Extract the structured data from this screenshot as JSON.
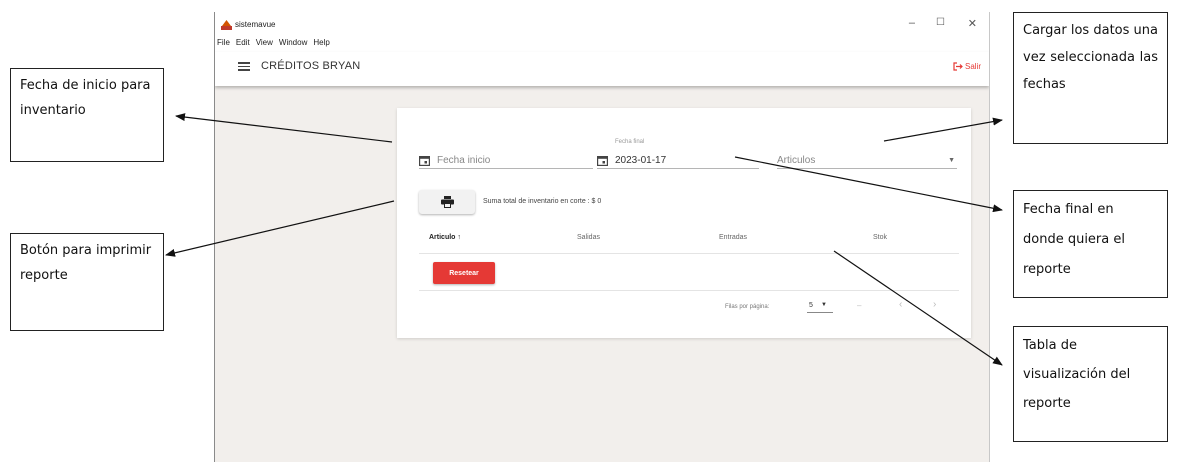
{
  "window": {
    "app_title": "sistemavue",
    "controls": {
      "minimize": "–",
      "maximize": "☐",
      "close": "✕"
    },
    "menu": [
      "File",
      "Edit",
      "View",
      "Window",
      "Help"
    ]
  },
  "toolbar": {
    "title": "CRÉDITOS BRYAN",
    "logout_label": "Salir"
  },
  "filters": {
    "start_date": {
      "placeholder": "Fecha inicio",
      "value": ""
    },
    "end_date": {
      "label": "Fecha final",
      "value": "2023-01-17"
    },
    "articles": {
      "placeholder": "Articulos",
      "value": ""
    }
  },
  "summary": {
    "text": "Suma total de inventario en corte : $ 0"
  },
  "table": {
    "headers": [
      "Articulo ↑",
      "Salidas",
      "Entradas",
      "Stok"
    ],
    "rows": []
  },
  "reset_button": {
    "label": "Resetear"
  },
  "pagination": {
    "rows_per_page_label": "Filas por página:",
    "rows_per_page": "5",
    "range": "–"
  },
  "annotations": {
    "start": "Fecha de inicio para inventario",
    "print": "Botón para imprimir reporte",
    "load": "Cargar los datos una vez seleccionada las fechas",
    "end": "Fecha final en donde quiera el reporte",
    "table": "Tabla de visualización del reporte"
  },
  "colors": {
    "accent_red": "#e53935",
    "background": "#f2efec"
  }
}
